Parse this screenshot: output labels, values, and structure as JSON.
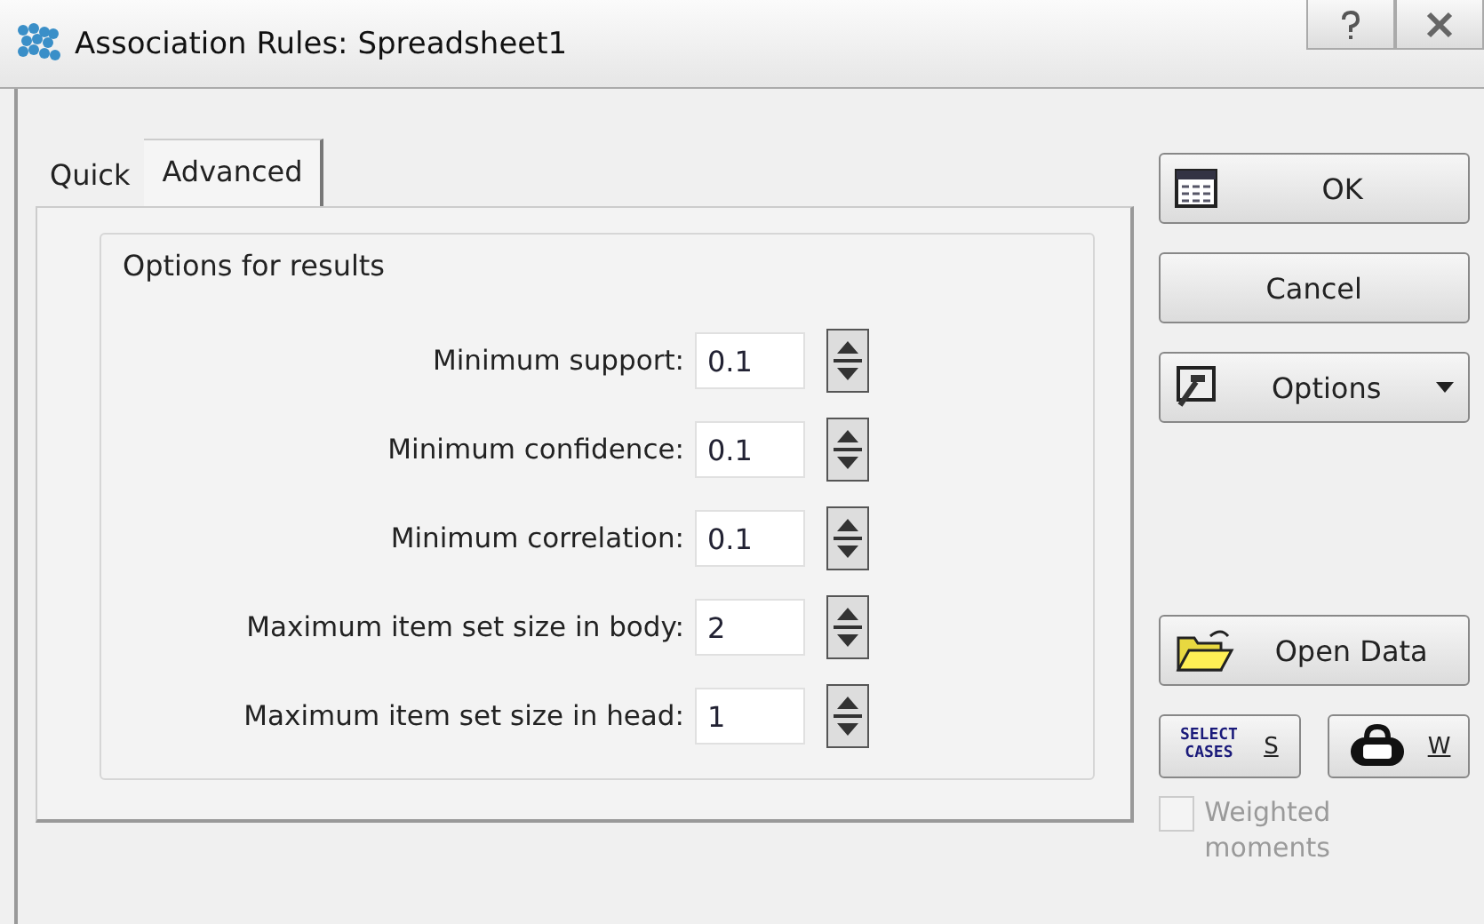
{
  "window": {
    "title": "Association Rules: Spreadsheet1"
  },
  "tabs": [
    {
      "label": "Quick",
      "selected": false
    },
    {
      "label": "Advanced",
      "selected": true
    }
  ],
  "group": {
    "title": "Options for results"
  },
  "fields": [
    {
      "label": "Minimum support:",
      "value": "0.1"
    },
    {
      "label": "Minimum confidence:",
      "value": "0.1"
    },
    {
      "label": "Minimum correlation:",
      "value": "0.1"
    },
    {
      "label": "Maximum item set size in body:",
      "value": "2"
    },
    {
      "label": "Maximum item set size in head:",
      "value": "1"
    }
  ],
  "buttons": {
    "ok": "OK",
    "cancel": "Cancel",
    "options": "Options",
    "open_data": "Open Data",
    "select_cases": "S",
    "weight": "W"
  },
  "select_cases_icon": {
    "line_1": "SELECT",
    "line_2": "CASES"
  },
  "weighted_moments": {
    "label": "Weighted moments",
    "checked": false,
    "disabled": true
  }
}
